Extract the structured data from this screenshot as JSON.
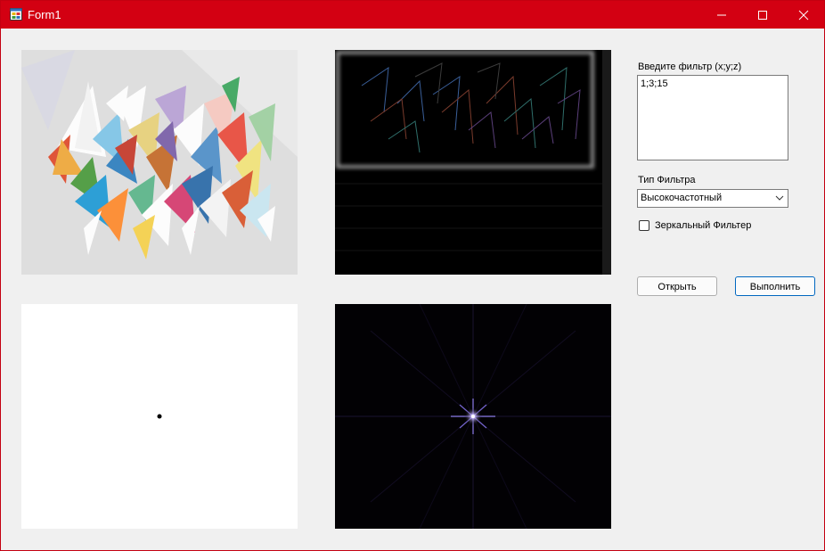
{
  "window": {
    "title": "Form1",
    "controls": [
      "minimize-icon",
      "maximize-icon",
      "close-icon"
    ]
  },
  "colors": {
    "titlebar": "#d30012",
    "client_bg": "#f0f0f0",
    "accent_button_border": "#0067c0"
  },
  "images": {
    "original": "abstract-triangles-image",
    "result": "filtered-result-image",
    "filter_mask": "filter-mask-image",
    "spectrum": "fourier-spectrum-image"
  },
  "filter_input": {
    "label": "Введите фильтр (x;y;z)",
    "value": "1;3;15"
  },
  "filter_type": {
    "label": "Тип Фильтра",
    "selected": "Высокочастотный"
  },
  "mirror_filter": {
    "label": "Зеркальный Фильтер",
    "checked": false
  },
  "buttons": {
    "open": "Открыть",
    "run": "Выполнить"
  }
}
